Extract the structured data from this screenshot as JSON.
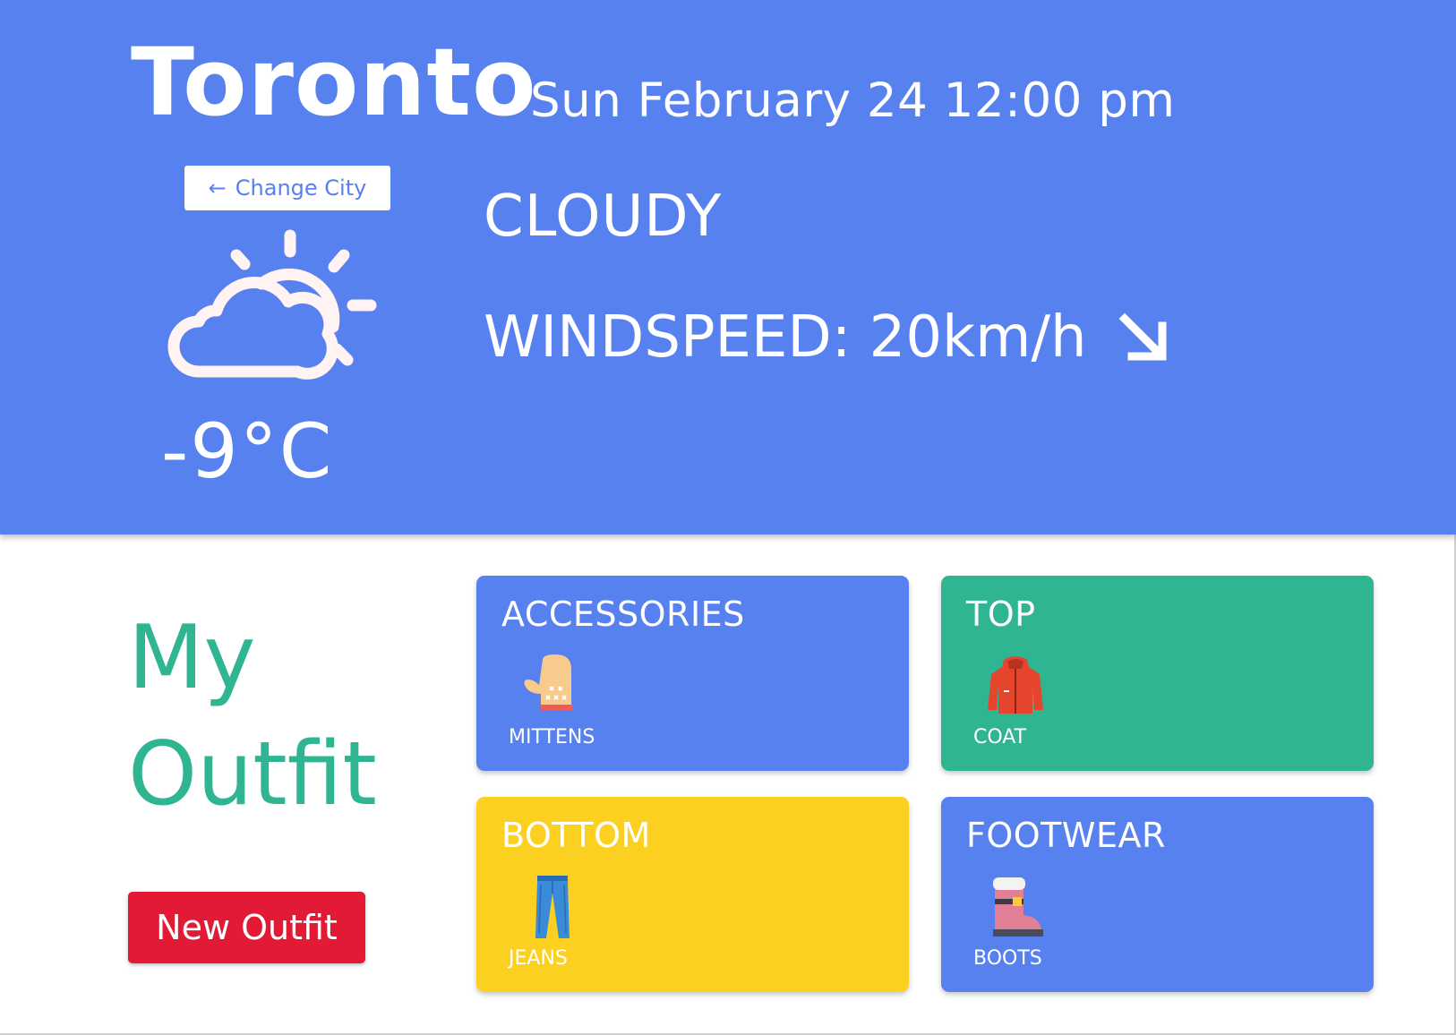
{
  "header": {
    "city": "Toronto",
    "datetime": "Sun February 24 12:00 pm",
    "change_city_label": "Change City",
    "change_city_arrow": "←",
    "condition": "CLOUDY",
    "wind_label": "WINDSPEED: 20km/h",
    "temperature": "-9°C",
    "weather_icon": "partly-cloudy-icon",
    "wind_direction_icon": "arrow-down-right-icon"
  },
  "outfit": {
    "heading_line1": "My",
    "heading_line2": "Outfit",
    "new_outfit_label": "New Outfit",
    "categories": [
      {
        "title": "ACCESSORIES",
        "item": "MITTENS",
        "icon": "mitten-icon",
        "color": "#5881F0"
      },
      {
        "title": "TOP",
        "item": "COAT",
        "icon": "coat-icon",
        "color": "#2FB591"
      },
      {
        "title": "BOTTOM",
        "item": "JEANS",
        "icon": "jeans-icon",
        "color": "#FCD020"
      },
      {
        "title": "FOOTWEAR",
        "item": "BOOTS",
        "icon": "boot-icon",
        "color": "#5881F0"
      }
    ]
  },
  "colors": {
    "header_bg": "#5881F0",
    "accent_green": "#2FB591",
    "button_red": "#E21A35",
    "accent_yellow": "#FCD020"
  }
}
